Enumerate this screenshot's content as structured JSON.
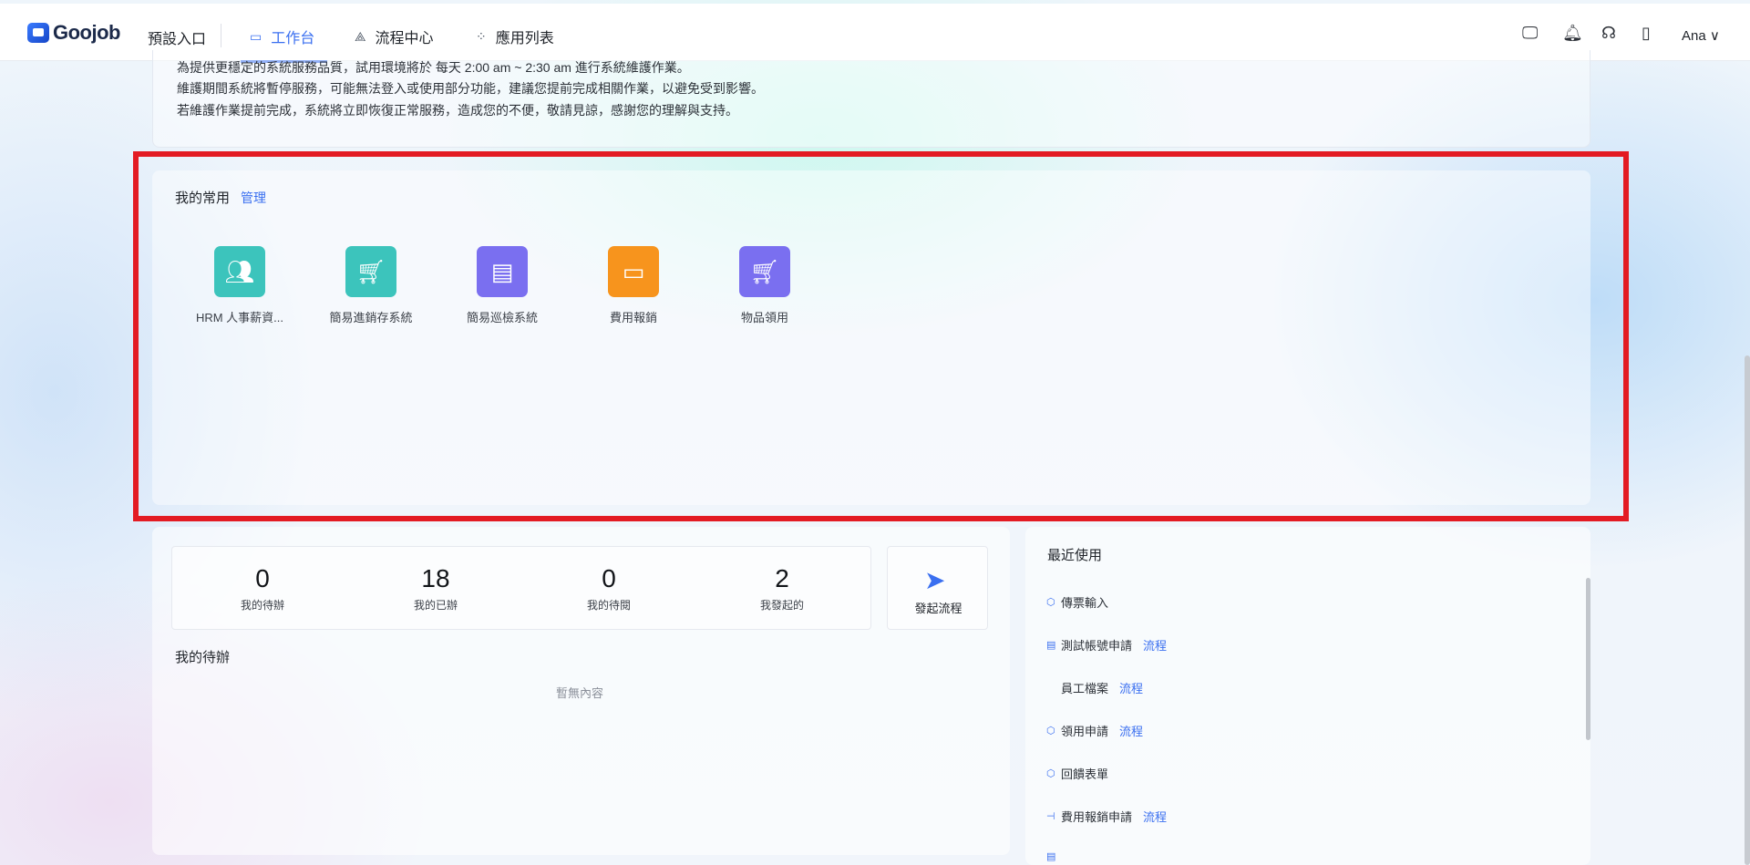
{
  "header": {
    "logo_text": "Goojob",
    "entry_label": "預設入口",
    "tabs": [
      {
        "label": "工作台",
        "icon": "monitor-icon"
      },
      {
        "label": "流程中心",
        "icon": "flow-icon"
      },
      {
        "label": "應用列表",
        "icon": "grid-icon"
      }
    ],
    "user_name": "Ana",
    "right_icons": [
      "desktop-icon",
      "bell-icon",
      "headset-icon",
      "book-icon"
    ]
  },
  "notice": {
    "line1": "為提供更穩定的系統服務品質，試用環境將於 每天 2:00 am ~ 2:30 am 進行系統維護作業。",
    "line2": "維護期間系統將暫停服務，可能無法登入或使用部分功能，建議您提前完成相關作業，以避免受到影響。",
    "line3": "若維護作業提前完成，系統將立即恢復正常服務，造成您的不便，敬請見諒，感謝您的理解與支持。"
  },
  "favorites": {
    "title": "我的常用",
    "manage_label": "管理",
    "apps": [
      {
        "label": "HRM 人事薪資...",
        "icon": "people-icon",
        "color": "#3cc4bc"
      },
      {
        "label": "簡易進銷存系統",
        "icon": "cart-icon",
        "color": "#3cc4bc"
      },
      {
        "label": "簡易巡檢系統",
        "icon": "clipboard-icon",
        "color": "#7a6ff0"
      },
      {
        "label": "費用報銷",
        "icon": "wallet-icon",
        "color": "#f7941d"
      },
      {
        "label": "物品領用",
        "icon": "cart-icon",
        "color": "#7a6ff0"
      }
    ]
  },
  "stats": [
    {
      "value": "0",
      "label": "我的待辦"
    },
    {
      "value": "18",
      "label": "我的已辦"
    },
    {
      "value": "0",
      "label": "我的待閱"
    },
    {
      "value": "2",
      "label": "我發起的"
    }
  ],
  "launch": {
    "label": "發起流程",
    "icon": "paper-plane-icon"
  },
  "todo": {
    "title": "我的待辦",
    "empty_text": "暫無內容"
  },
  "recent": {
    "title": "最近使用",
    "items": [
      {
        "label": "傳票輸入",
        "tag": "",
        "icon": "cube-icon"
      },
      {
        "label": "測試帳號申請",
        "tag": "流程",
        "icon": "form-icon"
      },
      {
        "label": "員工檔案",
        "tag": "流程",
        "icon": ""
      },
      {
        "label": "領用申請",
        "tag": "流程",
        "icon": "cube-icon"
      },
      {
        "label": "回饋表單",
        "tag": "",
        "icon": "cube-icon"
      },
      {
        "label": "費用報銷申請",
        "tag": "流程",
        "icon": "flow-node-icon"
      },
      {
        "label": "",
        "tag": "",
        "icon": "form-icon"
      }
    ]
  },
  "colors": {
    "accent": "#3a6ff0",
    "highlight": "#e31b23"
  }
}
